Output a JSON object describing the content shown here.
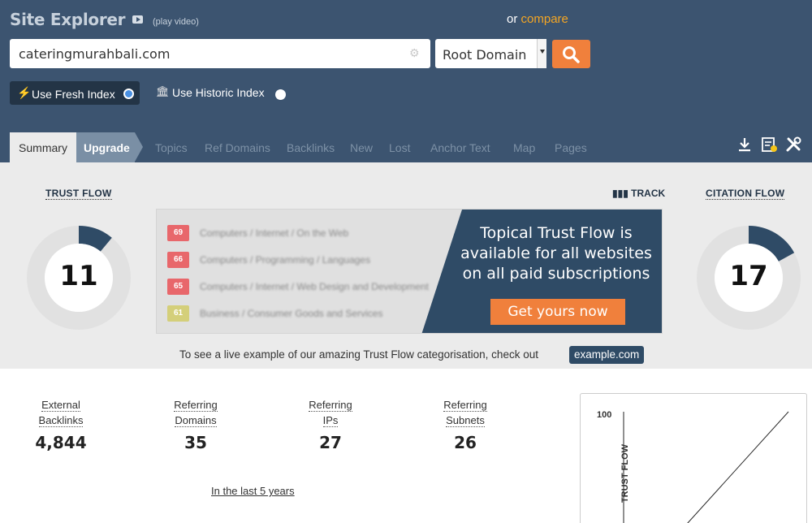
{
  "header": {
    "title": "Site Explorer",
    "play_video": "(play video)",
    "or": "or",
    "compare": "compare"
  },
  "search": {
    "value": "cateringmurahbali.com",
    "scope": "Root Domain",
    "options": [
      "Root Domain"
    ]
  },
  "index": {
    "fresh": "Use Fresh Index",
    "historic": "Use Historic Index",
    "selected": "fresh"
  },
  "tabs": [
    "Summary",
    "Upgrade",
    "Topics",
    "Ref Domains",
    "Backlinks",
    "New",
    "Lost",
    "Anchor Text",
    "Map",
    "Pages"
  ],
  "active_tab": "Summary",
  "trust_flow": {
    "label": "TRUST FLOW",
    "value": "11",
    "fraction": 0.11
  },
  "citation_flow": {
    "label": "CITATION FLOW",
    "value": "17",
    "fraction": 0.17
  },
  "track": "TRACK",
  "promo": {
    "rows": [
      {
        "score": "69",
        "text": "Computers / Internet / On the Web",
        "color": "#e8676b"
      },
      {
        "score": "66",
        "text": "Computers / Programming / Languages",
        "color": "#e8676b"
      },
      {
        "score": "65",
        "text": "Computers / Internet / Web Design and Development",
        "color": "#e8676b"
      },
      {
        "score": "61",
        "text": "Business / Consumer Goods and Services",
        "color": "#d4cf7a"
      }
    ],
    "heading": "Topical Trust Flow is available for all websites on all paid subscriptions",
    "button": "Get yours now"
  },
  "live_example": {
    "text": "To see a live example of our amazing Trust Flow categorisation, check out",
    "link": "example.com"
  },
  "stats": [
    {
      "line1": "External",
      "line2": "Backlinks",
      "value": "4,844"
    },
    {
      "line1": "Referring",
      "line2": "Domains",
      "value": "35"
    },
    {
      "line1": "Referring",
      "line2": "IPs",
      "value": "27"
    },
    {
      "line1": "Referring",
      "line2": "Subnets",
      "value": "26"
    }
  ],
  "last_years": "In the last 5 years",
  "graph": {
    "ymax": "100",
    "ylabel": "TRUST FLOW"
  },
  "colors": {
    "header": "#3c5470",
    "accent": "#f0803c",
    "donut": "#2f4b66",
    "compare": "#f5a623"
  }
}
